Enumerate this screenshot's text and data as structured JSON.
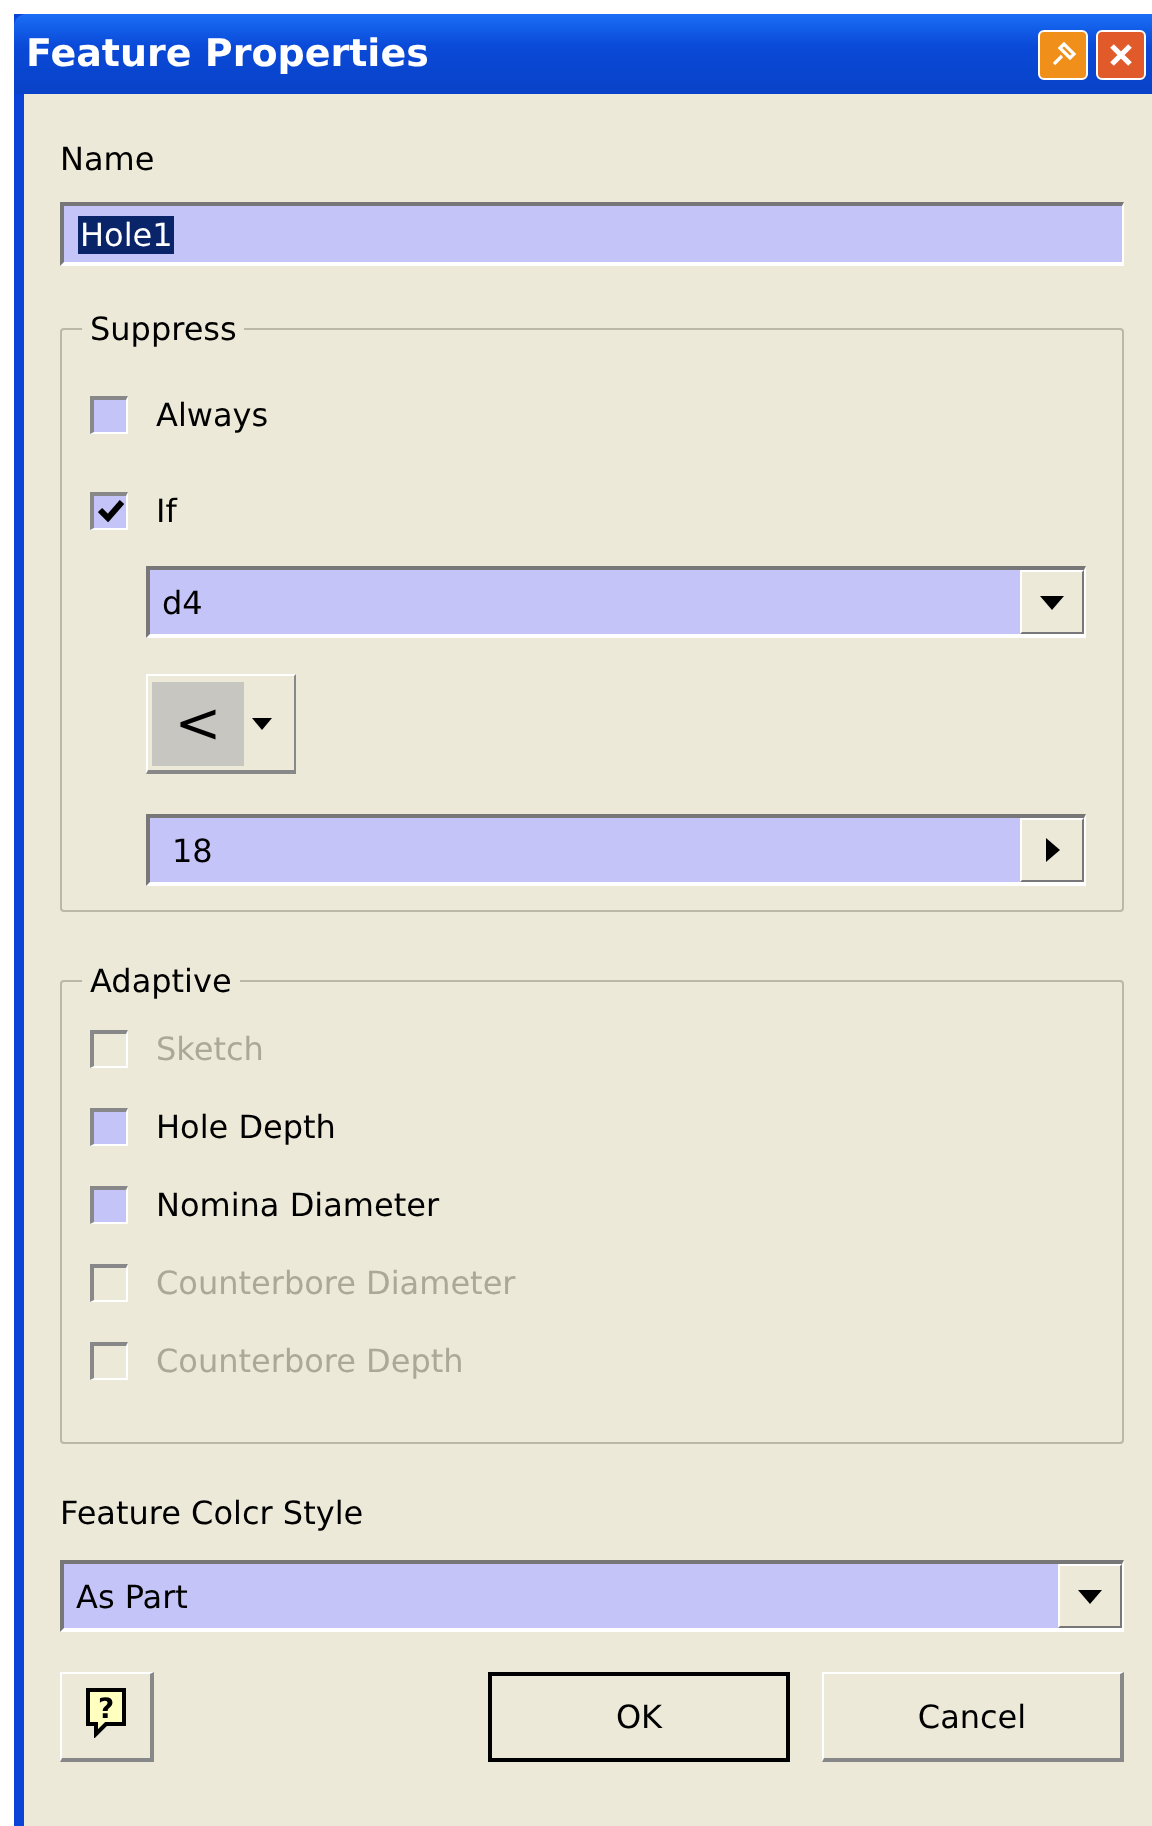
{
  "window": {
    "title": "Feature Properties"
  },
  "name": {
    "label": "Name",
    "value": "Hole1"
  },
  "suppress": {
    "title": "Suppress",
    "options": [
      {
        "label": "Always",
        "checked": false,
        "disabled": false
      },
      {
        "label": "If",
        "checked": true,
        "disabled": false
      }
    ],
    "parameter": "d4",
    "operator": "<",
    "value": "18"
  },
  "adaptive": {
    "title": "Adaptive",
    "options": [
      {
        "label": "Sketch",
        "checked": false,
        "disabled": true
      },
      {
        "label": "Hole Depth",
        "checked": false,
        "disabled": false
      },
      {
        "label": "Nomina Diameter",
        "checked": false,
        "disabled": false
      },
      {
        "label": "Counterbore Diameter",
        "checked": false,
        "disabled": true
      },
      {
        "label": "Counterbore Depth",
        "checked": false,
        "disabled": true
      }
    ]
  },
  "color_style": {
    "label": "Feature Colcr Style",
    "value": "As Part"
  },
  "help_button": "?",
  "buttons": [
    "OK",
    "Cancel"
  ]
}
